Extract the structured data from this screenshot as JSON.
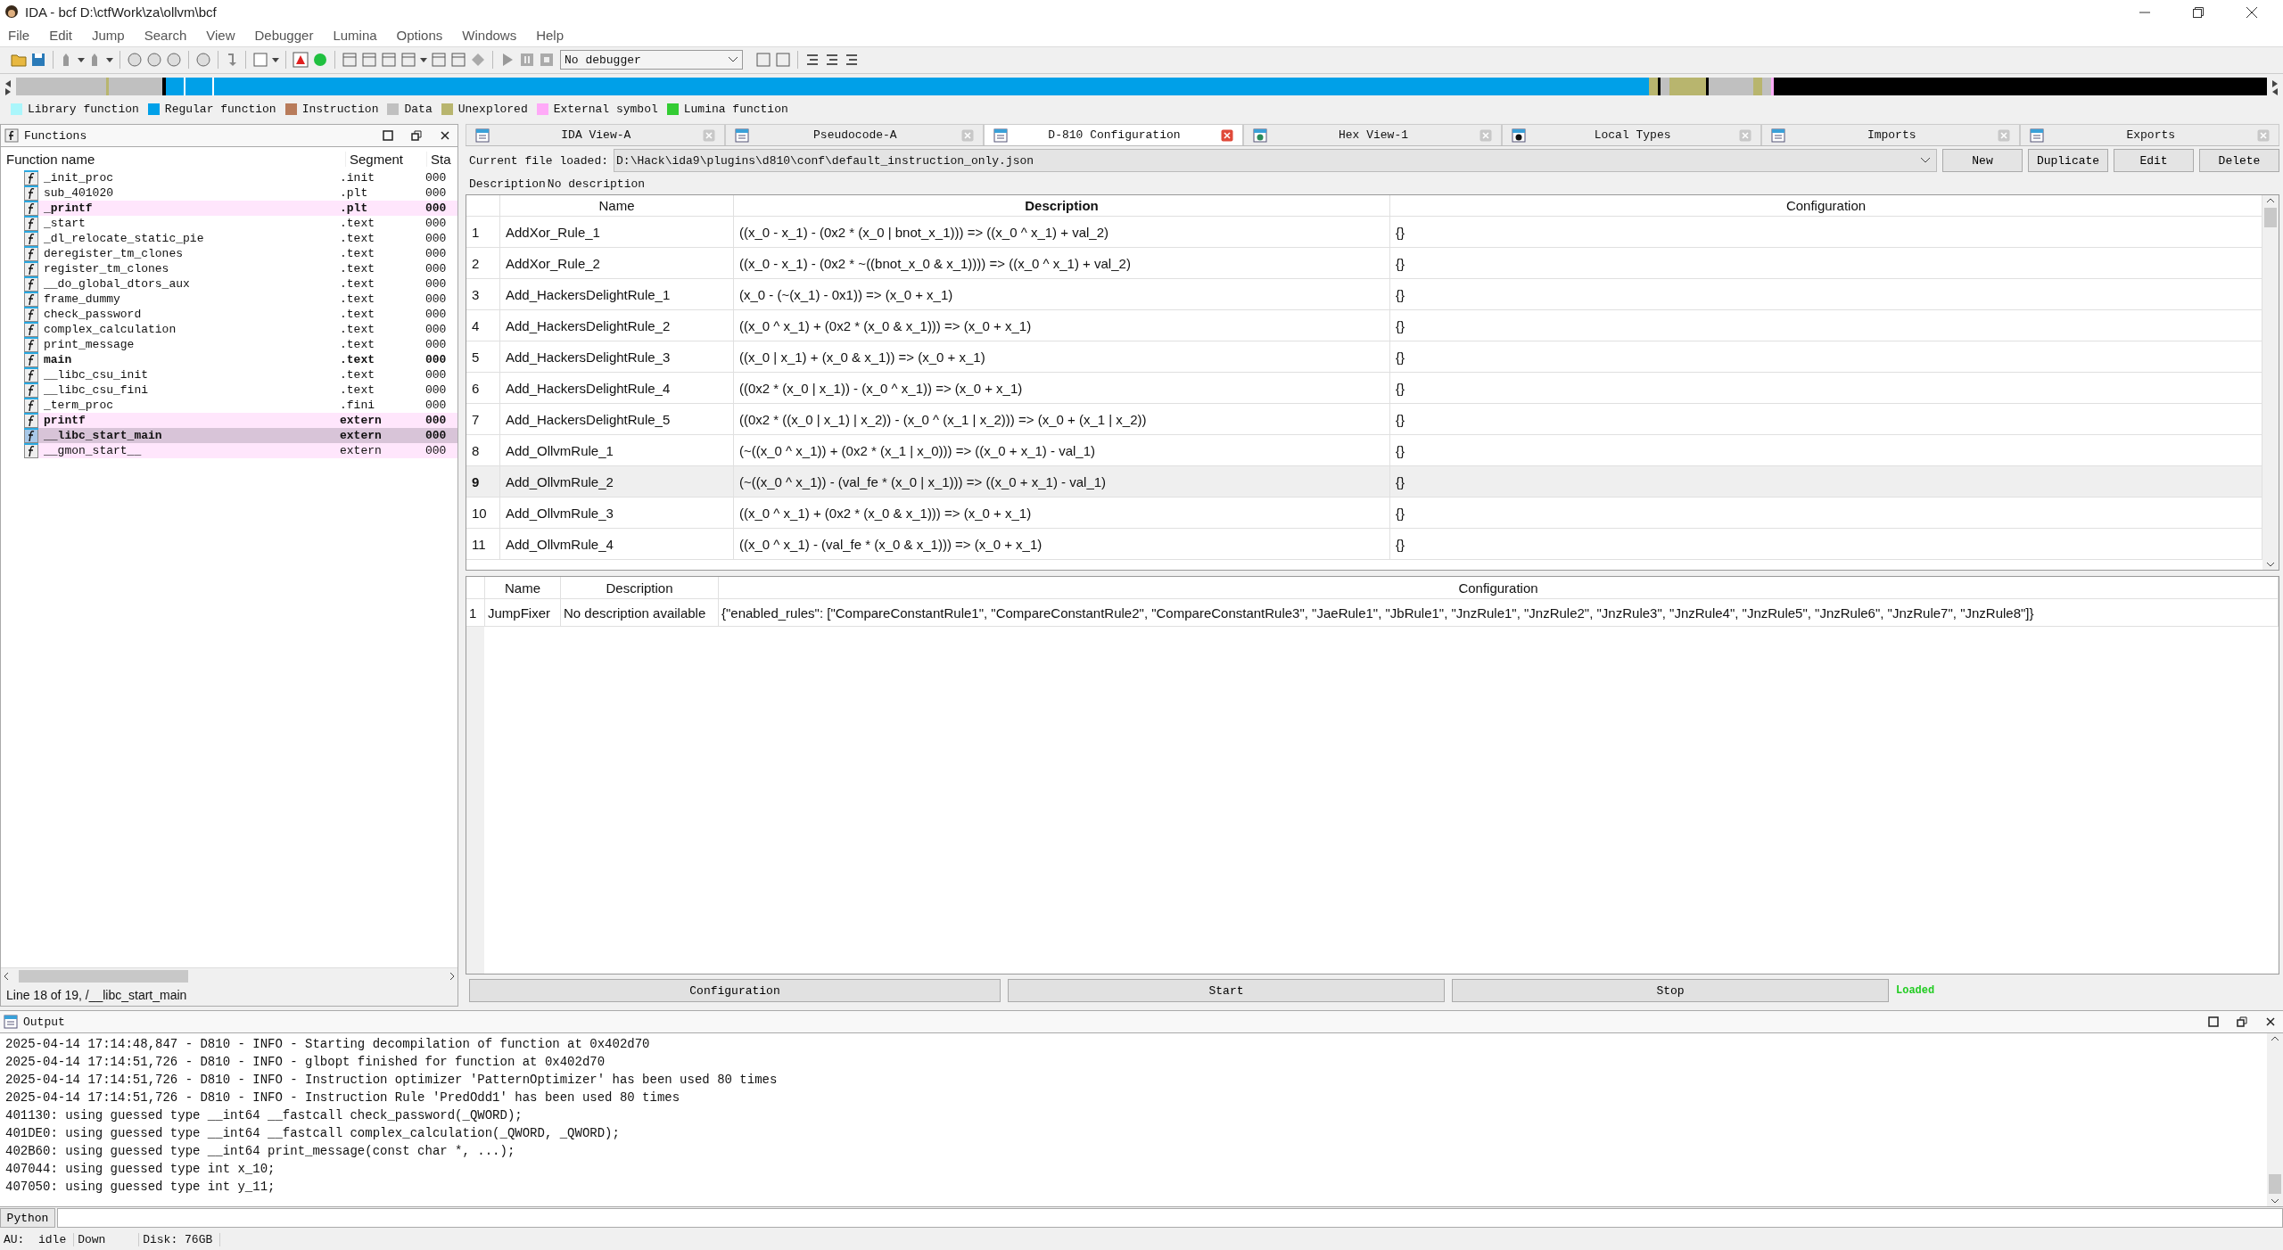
{
  "window": {
    "title": "IDA - bcf D:\\ctfWork\\za\\ollvm\\bcf"
  },
  "menu": [
    "File",
    "Edit",
    "Jump",
    "Search",
    "View",
    "Debugger",
    "Lumina",
    "Options",
    "Windows",
    "Help"
  ],
  "toolbar": {
    "debugger": "No debugger"
  },
  "legend": [
    {
      "label": "Library function",
      "color": "#aaf6fb"
    },
    {
      "label": "Regular function",
      "color": "#00a0e8"
    },
    {
      "label": "Instruction",
      "color": "#b87b5a"
    },
    {
      "label": "Data",
      "color": "#c0c0c0"
    },
    {
      "label": "Unexplored",
      "color": "#b8b56e"
    },
    {
      "label": "External symbol",
      "color": "#ffaaf8"
    },
    {
      "label": "Lumina function",
      "color": "#33cc33"
    }
  ],
  "functions_panel": {
    "title": "Functions",
    "columns": [
      "Function name",
      "Segment",
      "Sta"
    ],
    "rows": [
      {
        "name": "_init_proc",
        "segment": ".init",
        "start": "000",
        "bold": false,
        "external": false,
        "selected": false
      },
      {
        "name": "sub_401020",
        "segment": ".plt",
        "start": "000",
        "bold": false,
        "external": false,
        "selected": false
      },
      {
        "name": "_printf",
        "segment": ".plt",
        "start": "000",
        "bold": true,
        "external": true,
        "selected": false
      },
      {
        "name": "_start",
        "segment": ".text",
        "start": "000",
        "bold": false,
        "external": false,
        "selected": false
      },
      {
        "name": "_dl_relocate_static_pie",
        "segment": ".text",
        "start": "000",
        "bold": false,
        "external": false,
        "selected": false
      },
      {
        "name": "deregister_tm_clones",
        "segment": ".text",
        "start": "000",
        "bold": false,
        "external": false,
        "selected": false
      },
      {
        "name": "register_tm_clones",
        "segment": ".text",
        "start": "000",
        "bold": false,
        "external": false,
        "selected": false
      },
      {
        "name": "__do_global_dtors_aux",
        "segment": ".text",
        "start": "000",
        "bold": false,
        "external": false,
        "selected": false
      },
      {
        "name": "frame_dummy",
        "segment": ".text",
        "start": "000",
        "bold": false,
        "external": false,
        "selected": false
      },
      {
        "name": "check_password",
        "segment": ".text",
        "start": "000",
        "bold": false,
        "external": false,
        "selected": false
      },
      {
        "name": "complex_calculation",
        "segment": ".text",
        "start": "000",
        "bold": false,
        "external": false,
        "selected": false
      },
      {
        "name": "print_message",
        "segment": ".text",
        "start": "000",
        "bold": false,
        "external": false,
        "selected": false
      },
      {
        "name": "main",
        "segment": ".text",
        "start": "000",
        "bold": true,
        "external": false,
        "selected": false
      },
      {
        "name": "__libc_csu_init",
        "segment": ".text",
        "start": "000",
        "bold": false,
        "external": false,
        "selected": false
      },
      {
        "name": "__libc_csu_fini",
        "segment": ".text",
        "start": "000",
        "bold": false,
        "external": false,
        "selected": false
      },
      {
        "name": "_term_proc",
        "segment": ".fini",
        "start": "000",
        "bold": false,
        "external": false,
        "selected": false
      },
      {
        "name": "printf",
        "segment": "extern",
        "start": "000",
        "bold": true,
        "external": true,
        "selected": false
      },
      {
        "name": "__libc_start_main",
        "segment": "extern",
        "start": "000",
        "bold": true,
        "external": true,
        "selected": true
      },
      {
        "name": "__gmon_start__",
        "segment": "extern",
        "start": "000",
        "bold": false,
        "external": true,
        "selected": false
      }
    ],
    "status": "Line 18 of 19, /__libc_start_main"
  },
  "tabs": [
    {
      "label": "IDA View-A",
      "selected": false
    },
    {
      "label": "Pseudocode-A",
      "selected": false
    },
    {
      "label": "D-810 Configuration",
      "selected": true
    },
    {
      "label": "Hex View-1",
      "selected": false
    },
    {
      "label": "Local Types",
      "selected": false
    },
    {
      "label": "Imports",
      "selected": false
    },
    {
      "label": "Exports",
      "selected": false
    }
  ],
  "config": {
    "file_label": "Current file loaded:",
    "file": "D:\\Hack\\ida9\\plugins\\d810\\conf\\default_instruction_only.json",
    "buttons": [
      "New",
      "Duplicate",
      "Edit",
      "Delete"
    ],
    "description_label": "Description",
    "description": "No description",
    "rules_table": {
      "columns": [
        {
          "label": "Name",
          "bold": false
        },
        {
          "label": "Description",
          "bold": true
        },
        {
          "label": "Configuration",
          "bold": false
        }
      ],
      "rows": [
        {
          "index": "1",
          "name": "AddXor_Rule_1",
          "description": "((x_0 - x_1) - (0x2 * (x_0 | bnot_x_1))) => ((x_0 ^ x_1) + val_2)",
          "configuration": "{}",
          "selected": false
        },
        {
          "index": "2",
          "name": "AddXor_Rule_2",
          "description": "((x_0 - x_1) - (0x2 * ~((bnot_x_0 & x_1)))) => ((x_0 ^ x_1) + val_2)",
          "configuration": "{}",
          "selected": false
        },
        {
          "index": "3",
          "name": "Add_HackersDelightRule_1",
          "description": "(x_0 - (~(x_1) - 0x1)) => (x_0 + x_1)",
          "configuration": "{}",
          "selected": false
        },
        {
          "index": "4",
          "name": "Add_HackersDelightRule_2",
          "description": "((x_0 ^ x_1) + (0x2 * (x_0 & x_1))) => (x_0 + x_1)",
          "configuration": "{}",
          "selected": false
        },
        {
          "index": "5",
          "name": "Add_HackersDelightRule_3",
          "description": "((x_0 | x_1) + (x_0 & x_1)) => (x_0 + x_1)",
          "configuration": "{}",
          "selected": false
        },
        {
          "index": "6",
          "name": "Add_HackersDelightRule_4",
          "description": "((0x2 * (x_0 | x_1)) - (x_0 ^ x_1)) => (x_0 + x_1)",
          "configuration": "{}",
          "selected": false
        },
        {
          "index": "7",
          "name": "Add_HackersDelightRule_5",
          "description": "((0x2 * ((x_0 | x_1) | x_2)) - (x_0 ^ (x_1 | x_2))) => (x_0 + (x_1 | x_2))",
          "configuration": "{}",
          "selected": false
        },
        {
          "index": "8",
          "name": "Add_OllvmRule_1",
          "description": "(~((x_0 ^ x_1)) + (0x2 * (x_1 | x_0))) => ((x_0 + x_1) - val_1)",
          "configuration": "{}",
          "selected": false
        },
        {
          "index": "9",
          "name": "Add_OllvmRule_2",
          "description": "(~((x_0 ^ x_1)) - (val_fe * (x_0 | x_1))) => ((x_0 + x_1) - val_1)",
          "configuration": "{}",
          "selected": true
        },
        {
          "index": "10",
          "name": "Add_OllvmRule_3",
          "description": "((x_0 ^ x_1) + (0x2 * (x_0 & x_1))) => (x_0 + x_1)",
          "configuration": "{}",
          "selected": false
        },
        {
          "index": "11",
          "name": "Add_OllvmRule_4",
          "description": "((x_0 ^ x_1) - (val_fe * (x_0 & x_1))) => (x_0 + x_1)",
          "configuration": "{}",
          "selected": false
        }
      ]
    },
    "block_table": {
      "columns": [
        {
          "label": "Name",
          "bold": false
        },
        {
          "label": "Description",
          "bold": false
        },
        {
          "label": "Configuration",
          "bold": false
        }
      ],
      "rows": [
        {
          "index": "1",
          "name": "JumpFixer",
          "description": "No description available",
          "configuration": "{\"enabled_rules\": [\"CompareConstantRule1\", \"CompareConstantRule2\", \"CompareConstantRule3\", \"JaeRule1\", \"JbRule1\", \"JnzRule1\", \"JnzRule2\", \"JnzRule3\", \"JnzRule4\", \"JnzRule5\", \"JnzRule6\", \"JnzRule7\", \"JnzRule8\"]}",
          "selected": false
        }
      ]
    },
    "actions": [
      "Configuration",
      "Start",
      "Stop"
    ],
    "status": "Loaded"
  },
  "output": {
    "title": "Output",
    "lines": [
      "2025-04-14 17:14:48,847 - D810 - INFO - Starting decompilation of function at 0x402d70",
      "2025-04-14 17:14:51,726 - D810 - INFO - glbopt finished for function at 0x402d70",
      "2025-04-14 17:14:51,726 - D810 - INFO - Instruction optimizer 'PatternOptimizer' has been used 80 times",
      "2025-04-14 17:14:51,726 - D810 - INFO - Instruction Rule 'PredOdd1' has been used 80 times",
      "401130: using guessed type __int64 __fastcall check_password(_QWORD);",
      "401DE0: using guessed type __int64 __fastcall complex_calculation(_QWORD, _QWORD);",
      "402B60: using guessed type __int64 print_message(const char *, ...);",
      "407044: using guessed type int x_10;",
      "407050: using guessed type int y_11;"
    ],
    "input_label": "Python"
  },
  "status_bar": [
    "AU:  idle",
    "Down",
    "Disk: 76GB"
  ]
}
